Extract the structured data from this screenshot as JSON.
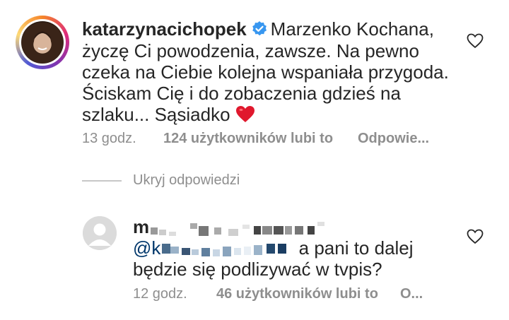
{
  "comment": {
    "username": "katarzynacichopek",
    "text_line1": "Marzenko Kochana,",
    "text_rest": "życzę Ci powodzenia, zawsze. Na pewno czeka na Ciebie kolejna wspaniała przygoda. Ściskam Cię i do zobaczenia gdzieś na szlaku... Sąsiadko",
    "time": "13 godz.",
    "likes": "124 użytkowników lubi to",
    "reply_label": "Odpowie..."
  },
  "replies_toggle": "Ukryj odpowiedzi",
  "reply": {
    "username_visible": "m",
    "mention_visible": "@k",
    "text": "a pani to dalej będzie się podlizywać w tvpis?",
    "time": "12 godz.",
    "likes": "46 użytkowników lubi to",
    "reply_label": "O..."
  },
  "icons": {
    "verified": "verified-badge-icon",
    "heart_emoji": "red-heart-emoji",
    "like": "heart-outline-icon",
    "avatar_placeholder": "default-avatar-icon"
  },
  "colors": {
    "verified_blue": "#3897f0",
    "heart_red": "#e0182d",
    "meta_gray": "#8e8e8e"
  }
}
